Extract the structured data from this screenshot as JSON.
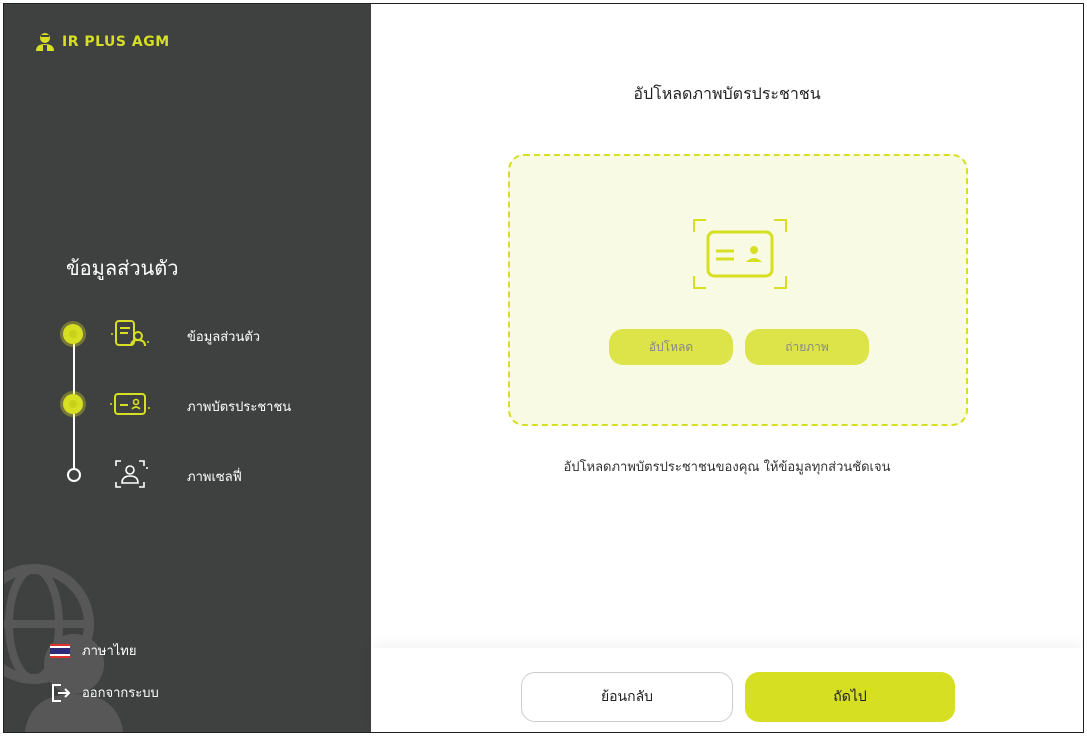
{
  "brand": {
    "name": "IR PLUS AGM",
    "accent": "#d7df23",
    "sidebar_bg": "#3f4040"
  },
  "sidebar": {
    "section_title": "ข้อมูลส่วนตัว",
    "steps": [
      {
        "label": "ข้อมูลส่วนตัว",
        "status": "done",
        "icon": "profile-form-icon"
      },
      {
        "label": "ภาพบัตรประชาชน",
        "status": "done",
        "icon": "id-card-icon"
      },
      {
        "label": "ภาพเซลฟี่",
        "status": "pending",
        "icon": "selfie-frame-icon"
      }
    ],
    "language_label": "ภาษาไทย",
    "logout_label": "ออกจากระบบ"
  },
  "main": {
    "title": "อัปโหลดภาพบัตรประชาชน",
    "upload_button": "อัปโหลด",
    "camera_button": "ถ่ายภาพ",
    "hint": "อัปโหลดภาพบัตรประชาชนของคุณ ให้ข้อมูลทุกส่วนชัดเจน"
  },
  "footer": {
    "back_label": "ย้อนกลับ",
    "next_label": "ถัดไป"
  }
}
